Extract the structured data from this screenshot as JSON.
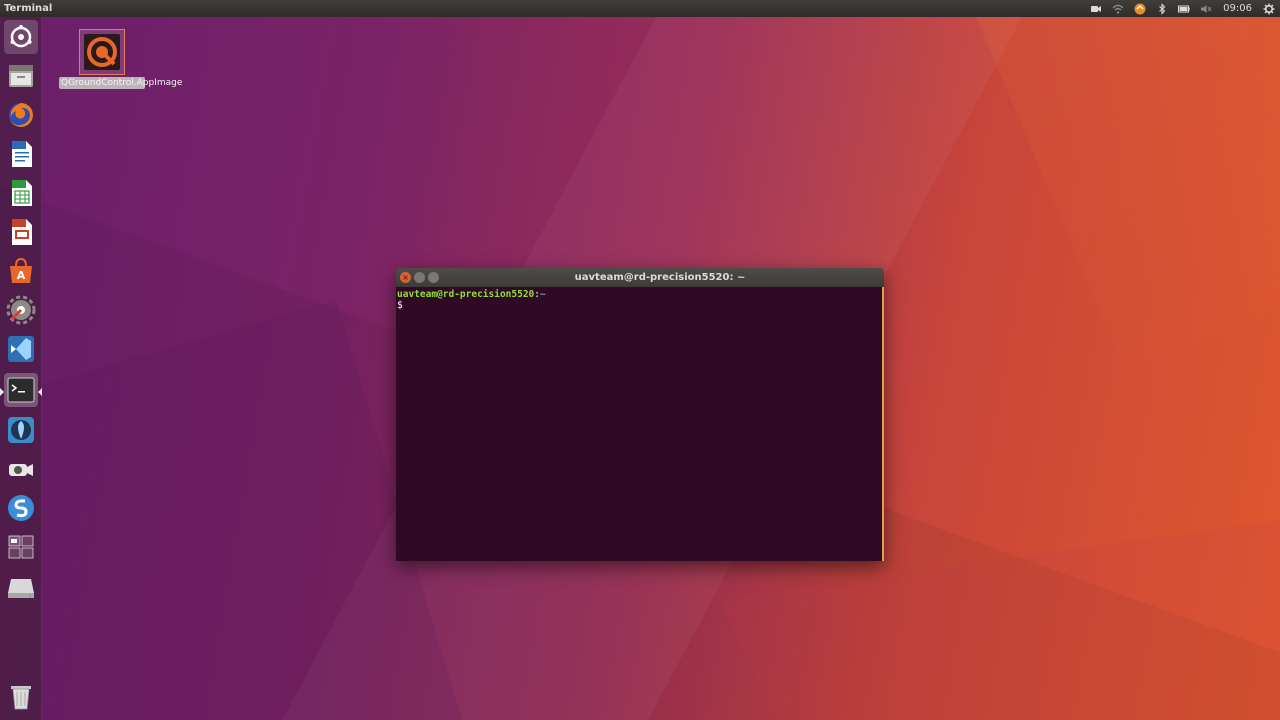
{
  "top_panel": {
    "app_title": "Terminal",
    "clock": "09:06",
    "indicators": [
      "video-icon",
      "wifi-icon",
      "update-icon",
      "bluetooth-icon",
      "battery-icon",
      "volume-icon",
      "gear-icon"
    ]
  },
  "launcher": {
    "items": [
      {
        "name": "dash-icon"
      },
      {
        "name": "files-icon"
      },
      {
        "name": "firefox-icon"
      },
      {
        "name": "writer-icon"
      },
      {
        "name": "calc-icon"
      },
      {
        "name": "impress-icon"
      },
      {
        "name": "software-center-icon"
      },
      {
        "name": "system-settings-icon"
      },
      {
        "name": "vscode-icon"
      },
      {
        "name": "terminal-icon",
        "active": true
      },
      {
        "name": "qgroundcontrol-icon"
      },
      {
        "name": "webcam-icon"
      },
      {
        "name": "simplenote-icon"
      },
      {
        "name": "workspace-switcher-icon"
      },
      {
        "name": "drive-icon"
      },
      {
        "name": "trash-icon"
      }
    ]
  },
  "desktop": {
    "icon_label": "QGroundControl.AppImage"
  },
  "terminal": {
    "title": "uavteam@rd-precision5520: ~",
    "prompt_user": "uavteam@rd-precision5520",
    "prompt_sep": ":",
    "prompt_path": "~",
    "prompt_symbol": "$"
  },
  "colors": {
    "terminal_bg": "#300a24",
    "prompt_green": "#8ae234",
    "prompt_blue": "#729fcf",
    "close_button": "#e25d2f"
  }
}
